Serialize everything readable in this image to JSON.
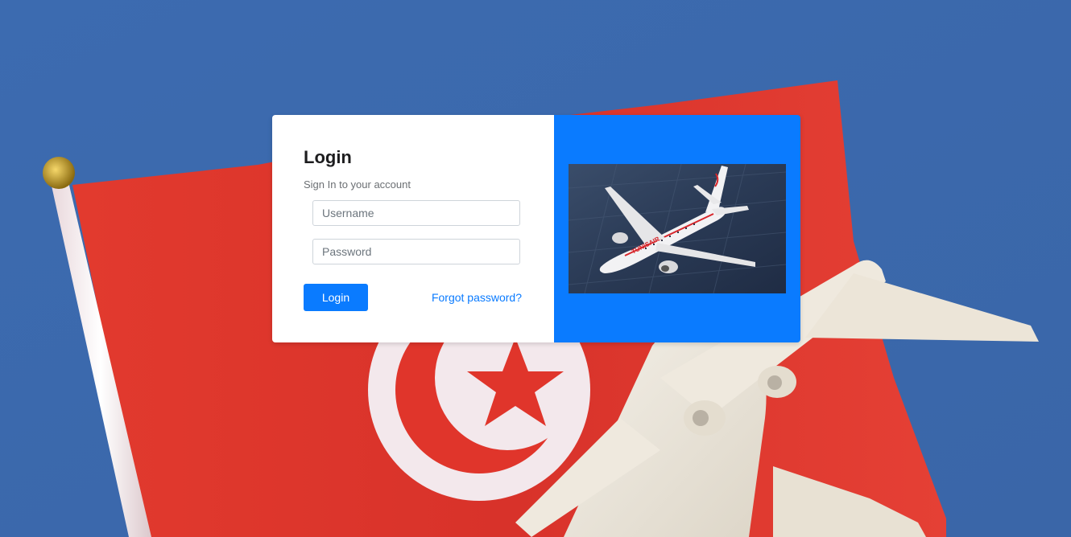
{
  "login": {
    "title": "Login",
    "subtitle": "Sign In to your account",
    "username_placeholder": "Username",
    "password_placeholder": "Password",
    "button_label": "Login",
    "forgot_label": "Forgot password?"
  },
  "colors": {
    "accent": "#0a7bff",
    "background_blue": "#3f6fb3",
    "flag_red": "#e0352b"
  },
  "background": {
    "description_icons": [
      "tunisia-flag-image",
      "toy-airplane-image"
    ]
  },
  "photo": {
    "icon": "airliner-photo",
    "livery_text": "TUNISAIR"
  }
}
